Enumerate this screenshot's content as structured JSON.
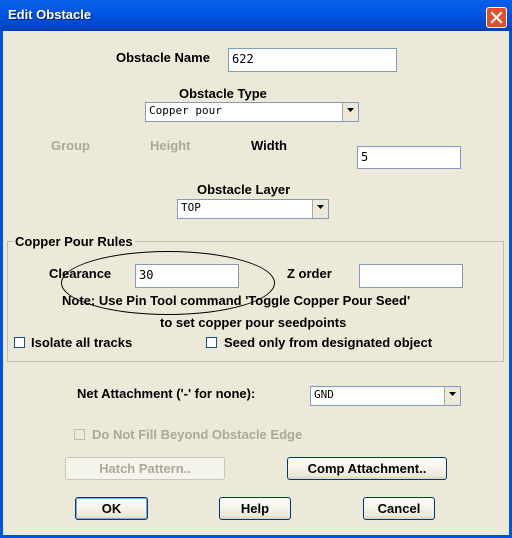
{
  "window": {
    "title": "Edit Obstacle"
  },
  "obstacle": {
    "name_label": "Obstacle Name",
    "name_value": "622",
    "type_label": "Obstacle Type",
    "type_value": "Copper pour",
    "group_label": "Group",
    "height_label": "Height",
    "width_label": "Width",
    "width_value": "5",
    "layer_label": "Obstacle Layer",
    "layer_value": "TOP"
  },
  "copper_pour": {
    "group_title": "Copper Pour Rules",
    "clearance_label": "Clearance",
    "clearance_value": "30",
    "zorder_label": "Z order",
    "zorder_value": "",
    "note_line1": "Note: Use Pin Tool command 'Toggle Copper Pour Seed'",
    "note_line2": "to set copper pour seedpoints",
    "isolate_label": "Isolate all tracks",
    "isolate_checked": false,
    "seed_label": "Seed only from designated object",
    "seed_checked": false
  },
  "net": {
    "label": "Net Attachment ('-' for none):",
    "value": "GND"
  },
  "fill_beyond": {
    "label": "Do Not Fill Beyond Obstacle Edge",
    "checked": false
  },
  "buttons": {
    "hatch": "Hatch Pattern..",
    "comp": "Comp Attachment..",
    "ok": "OK",
    "help": "Help",
    "cancel": "Cancel"
  },
  "colors": {
    "titlebar": "#0055e5",
    "face": "#ece9d8",
    "close": "#e14e2c"
  },
  "icons": {
    "close": "close-icon",
    "dropdown": "chevron-down-icon"
  }
}
